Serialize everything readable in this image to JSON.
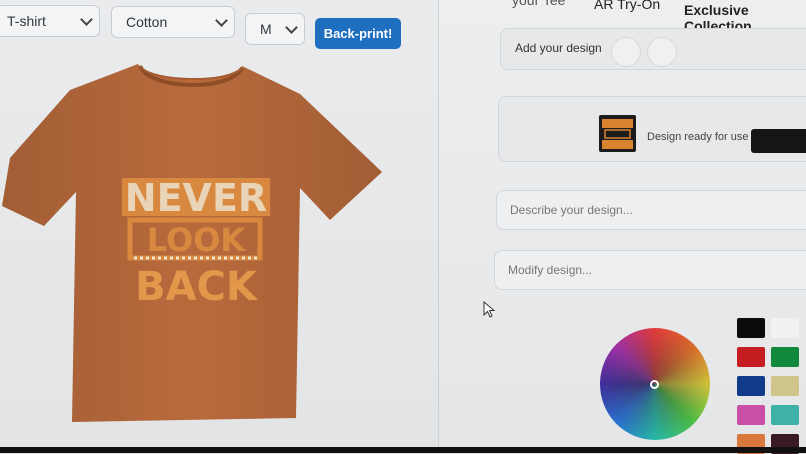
{
  "toolbar": {
    "product_select": "T-shirt",
    "material_select": "Cotton",
    "size_select": "M",
    "back_print_label": "Back-print!"
  },
  "top_nav": {
    "partial_item": "your Tee",
    "ar_try_on": "AR Try-On",
    "exclusive": "Exclusive Collection"
  },
  "design_panel": {
    "add_design_label": "Add your design",
    "design_status": "Design ready for use",
    "design_thumb_text": "NEVER LOOK BACK",
    "describe_placeholder": "Describe your design...",
    "modify_placeholder": "Modify design..."
  },
  "shirt": {
    "color": "#b86a3c",
    "print_text_line1": "NEVER",
    "print_text_line2": "LOOK",
    "print_text_line3": "BACK"
  },
  "palette": {
    "swatches": [
      "#0b0b0c",
      "#f1f1f1",
      "#c61d22",
      "#12883a",
      "#103a8a",
      "#cfc48a",
      "#c94fa6",
      "#3fb2a8",
      "#d8783a",
      "#3a1a22"
    ]
  }
}
